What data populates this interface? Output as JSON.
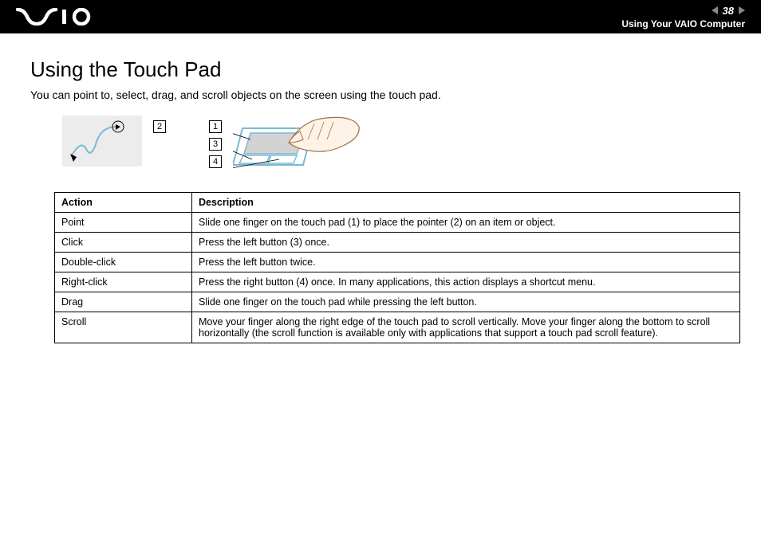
{
  "header": {
    "page_number": "38",
    "breadcrumb": "Using Your VAIO Computer"
  },
  "title": "Using the Touch Pad",
  "intro": "You can point to, select, drag, and scroll objects on the screen using the touch pad.",
  "callouts": {
    "c1": "1",
    "c2": "2",
    "c3": "3",
    "c4": "4"
  },
  "table": {
    "headers": {
      "action": "Action",
      "description": "Description"
    },
    "rows": [
      {
        "action": "Point",
        "description": "Slide one finger on the touch pad (1) to place the pointer (2) on an item or object."
      },
      {
        "action": "Click",
        "description": "Press the left button (3) once."
      },
      {
        "action": "Double-click",
        "description": "Press the left button twice."
      },
      {
        "action": "Right-click",
        "description": "Press the right button (4) once. In many applications, this action displays a shortcut menu."
      },
      {
        "action": "Drag",
        "description": "Slide one finger on the touch pad while pressing the left button."
      },
      {
        "action": "Scroll",
        "description": "Move your finger along the right edge of the touch pad to scroll vertically. Move your finger along the bottom to scroll horizontally (the scroll function is available only with applications that support a touch pad scroll feature)."
      }
    ]
  }
}
